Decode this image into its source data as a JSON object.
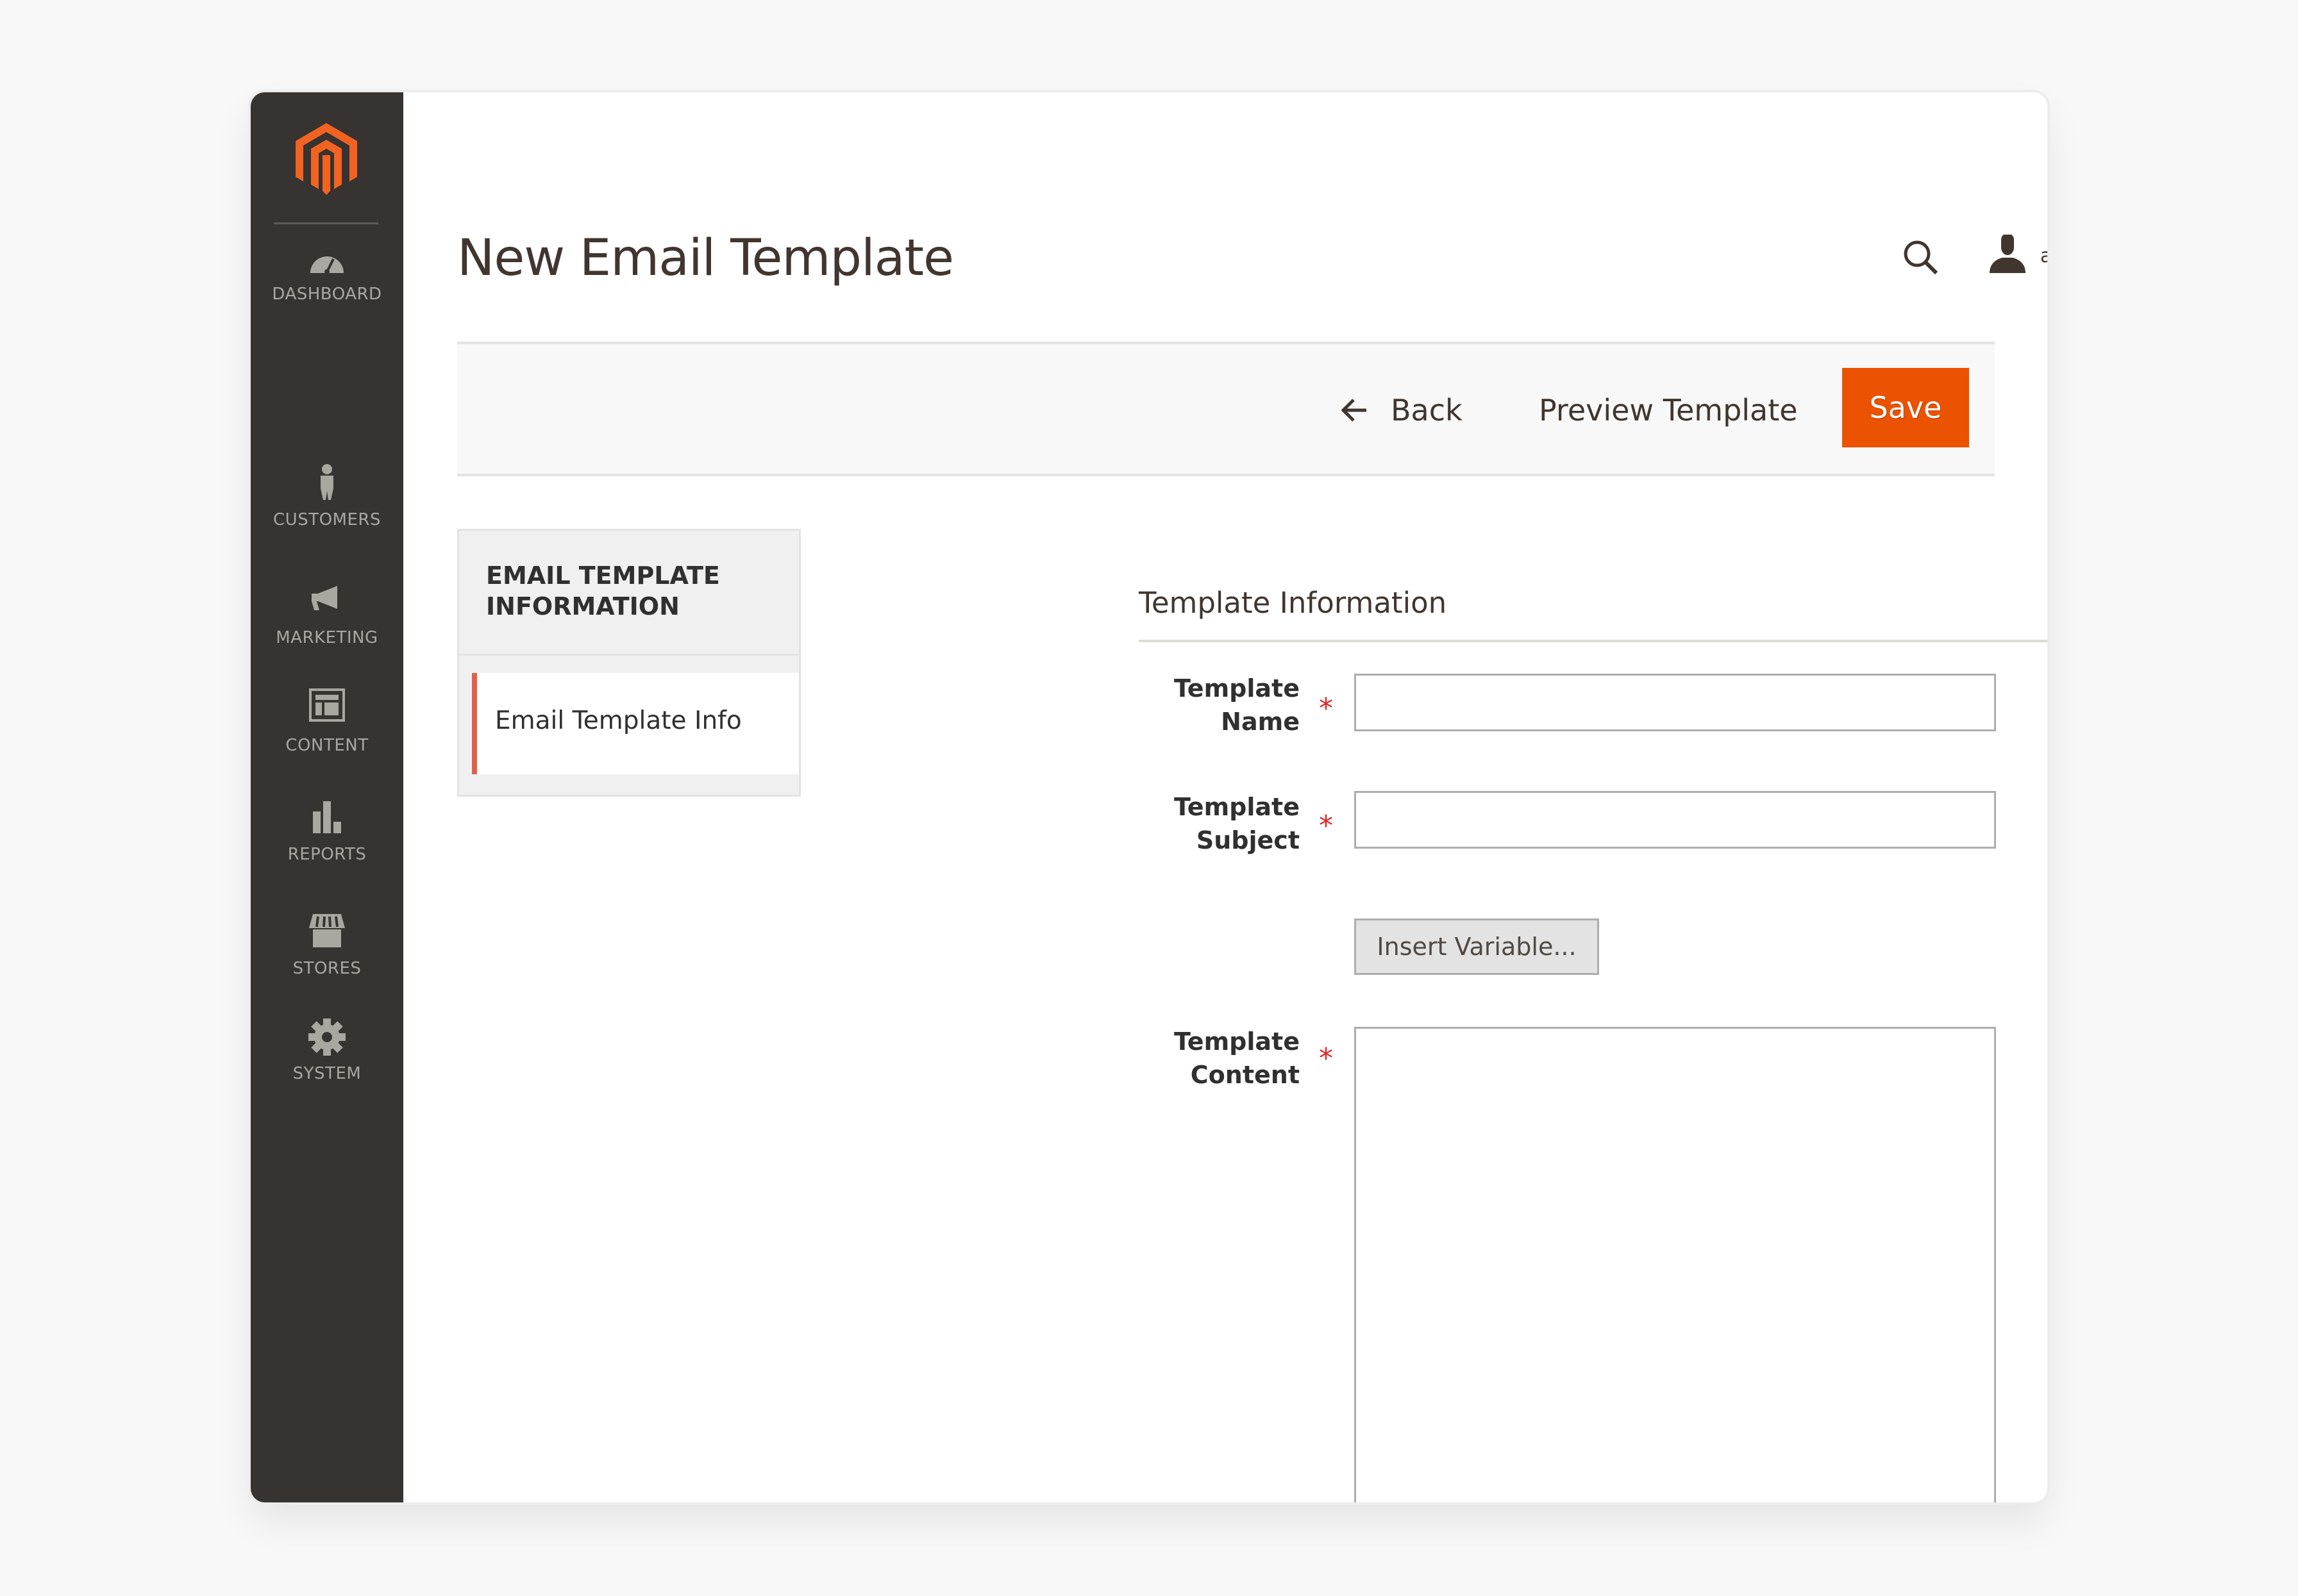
{
  "sidebar": {
    "logo": "magento-logo-icon",
    "items": [
      {
        "label": "Dashboard",
        "icon": "dashboard-gauge-icon"
      },
      {
        "label": "Customers",
        "icon": "customer-person-icon"
      },
      {
        "label": "Marketing",
        "icon": "megaphone-icon"
      },
      {
        "label": "Content",
        "icon": "content-layout-icon"
      },
      {
        "label": "Reports",
        "icon": "bar-chart-icon"
      },
      {
        "label": "Stores",
        "icon": "storefront-icon"
      },
      {
        "label": "System",
        "icon": "gear-icon"
      }
    ]
  },
  "header": {
    "title": "New Email Template",
    "user": "admin"
  },
  "action_bar": {
    "back_label": "Back",
    "preview_label": "Preview Template",
    "save_label": "Save"
  },
  "tabs": {
    "title": "Email Template Information",
    "items": [
      {
        "label": "Email Template Info",
        "active": true
      }
    ]
  },
  "form": {
    "section_title": "Template Information",
    "fields": {
      "name": {
        "label_line1": "Template",
        "label_line2": "Name",
        "value": "",
        "required": true
      },
      "subject": {
        "label_line1": "Template",
        "label_line2": "Subject",
        "value": "",
        "required": true
      },
      "content": {
        "label_line1": "Template",
        "label_line2": "Content",
        "value": "",
        "required": true
      }
    },
    "insert_variable_label": "Insert Variable...",
    "required_mark": "*"
  },
  "colors": {
    "accent": "#eb5202",
    "sidebar_bg": "#373330",
    "active_tab_border": "#e0614a",
    "required": "#e22626"
  }
}
